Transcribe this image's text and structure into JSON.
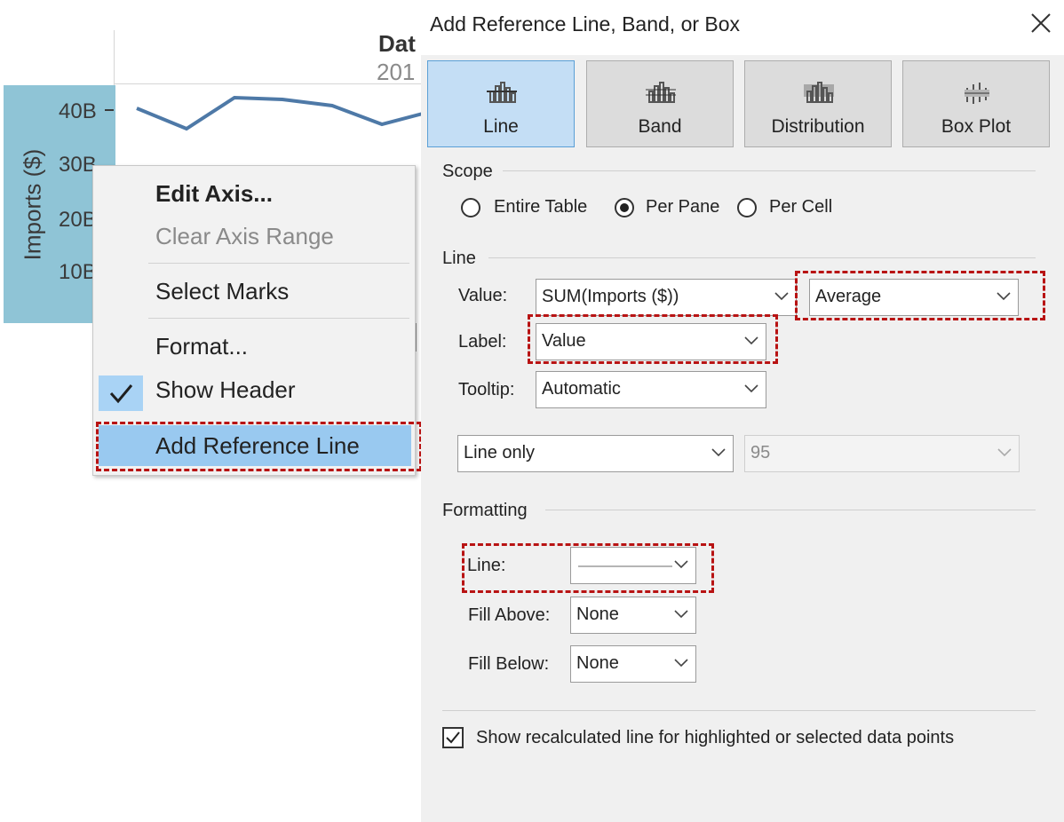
{
  "worksheet": {
    "header_top": "Dat",
    "header_sub": "201",
    "axis_title": "Imports ($)",
    "ticks": [
      "40B",
      "30B",
      "20B",
      "10B"
    ],
    "context_menu": {
      "edit_axis": "Edit Axis...",
      "clear_axis_range": "Clear Axis Range",
      "select_marks": "Select Marks",
      "format": "Format...",
      "show_header": "Show Header",
      "add_reference_line": "Add Reference Line"
    }
  },
  "dialog": {
    "title": "Add Reference Line, Band, or Box",
    "types": [
      {
        "label": "Line",
        "icon": "line-chart-icon",
        "selected": true
      },
      {
        "label": "Band",
        "icon": "band-icon",
        "selected": false
      },
      {
        "label": "Distribution",
        "icon": "distribution-icon",
        "selected": false
      },
      {
        "label": "Box Plot",
        "icon": "box-plot-icon",
        "selected": false
      }
    ],
    "scope": {
      "title": "Scope",
      "options": [
        "Entire Table",
        "Per Pane",
        "Per Cell"
      ],
      "selected": "Per Pane"
    },
    "line": {
      "title": "Line",
      "value_label": "Value:",
      "value_field": "SUM(Imports ($))",
      "aggregation": "Average",
      "label_label": "Label:",
      "label_value": "Value",
      "tooltip_label": "Tooltip:",
      "tooltip_value": "Automatic",
      "confidence_mode": "Line only",
      "confidence_value": "95"
    },
    "formatting": {
      "title": "Formatting",
      "line_label": "Line:",
      "fill_above_label": "Fill Above:",
      "fill_above_value": "None",
      "fill_below_label": "Fill Below:",
      "fill_below_value": "None"
    },
    "recalc_checkbox": {
      "label": "Show recalculated line for highlighted or selected data points",
      "checked": true
    }
  },
  "colors": {
    "accent_selected": "#c4def5",
    "menu_highlight": "#99c9f0",
    "annotation_red": "#b81313",
    "axis_band": "#8fc4d6",
    "line_series": "#4e79a7"
  }
}
